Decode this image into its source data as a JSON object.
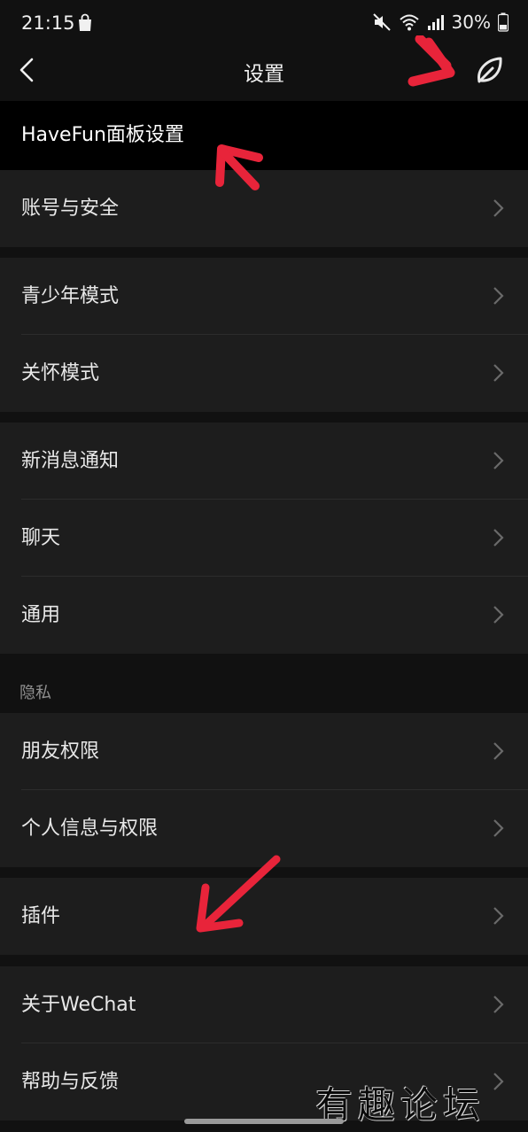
{
  "status_bar": {
    "time": "21:15",
    "battery": "30%"
  },
  "nav": {
    "title": "设置"
  },
  "rows": {
    "havefun": "HaveFun面板设置",
    "account": "账号与安全",
    "teen": "青少年模式",
    "care": "关怀模式",
    "notify": "新消息通知",
    "chat": "聊天",
    "general": "通用",
    "friends": "朋友权限",
    "personal": "个人信息与权限",
    "plugins": "插件",
    "about": "关于WeChat",
    "help": "帮助与反馈"
  },
  "sections": {
    "privacy": "隐私"
  },
  "watermark": "有趣论坛",
  "colors": {
    "annotation_red": "#e8243a",
    "row_bg": "#1d1d1d",
    "page_bg": "#111111"
  },
  "icons": [
    "shopping-bag-icon",
    "mute-icon",
    "wifi-icon",
    "signal-icon",
    "battery-icon",
    "back-arrow-icon",
    "leaf-icon",
    "chevron-right-icon"
  ]
}
